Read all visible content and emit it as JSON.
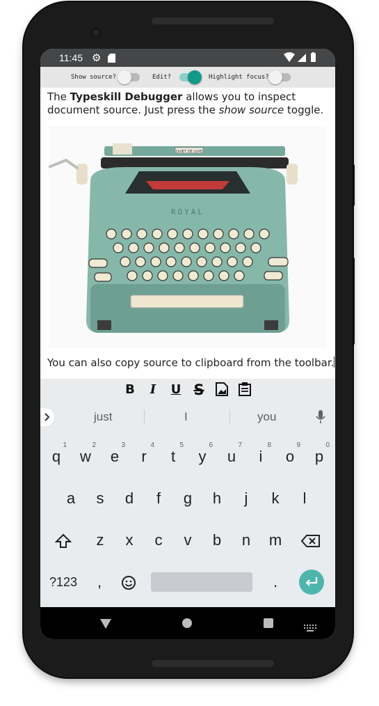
{
  "status_bar": {
    "time": "11:45"
  },
  "top_toolbar": {
    "show_source_label": "Show source?",
    "edit_label": "Edit?",
    "highlight_focus_label": "Highlight focus?",
    "show_source_on": false,
    "edit_on": true,
    "highlight_focus_on": false,
    "accent_color": "#12998a"
  },
  "document": {
    "p1_pre": "The ",
    "p1_bold": "Typeskill Debugger",
    "p1_mid": " allows you to inspect document source. Just press the ",
    "p1_italic": "show source",
    "p1_post": " toggle.",
    "p2": "You can also copy source to clipboard from the toolbar.",
    "image_lettering": {
      "plate": "QUIET DE LUXE",
      "brand": "ROYAL"
    }
  },
  "format_bar": {
    "bold": "B",
    "italic": "I",
    "underline": "U",
    "strike": "S",
    "icons": [
      "image-file-icon",
      "clipboard-icon"
    ]
  },
  "keyboard": {
    "suggestions": [
      "just",
      "I",
      "you"
    ],
    "row1": [
      {
        "k": "q",
        "n": "1"
      },
      {
        "k": "w",
        "n": "2"
      },
      {
        "k": "e",
        "n": "3"
      },
      {
        "k": "r",
        "n": "4"
      },
      {
        "k": "t",
        "n": "5"
      },
      {
        "k": "y",
        "n": "6"
      },
      {
        "k": "u",
        "n": "7"
      },
      {
        "k": "i",
        "n": "8"
      },
      {
        "k": "o",
        "n": "9"
      },
      {
        "k": "p",
        "n": "0"
      }
    ],
    "row2": [
      "a",
      "s",
      "d",
      "f",
      "g",
      "h",
      "j",
      "k",
      "l"
    ],
    "row3": [
      "z",
      "x",
      "c",
      "v",
      "b",
      "n",
      "m"
    ],
    "symbols": "?123",
    "comma": ",",
    "period": ".",
    "enter_color": "#4db6ac"
  }
}
